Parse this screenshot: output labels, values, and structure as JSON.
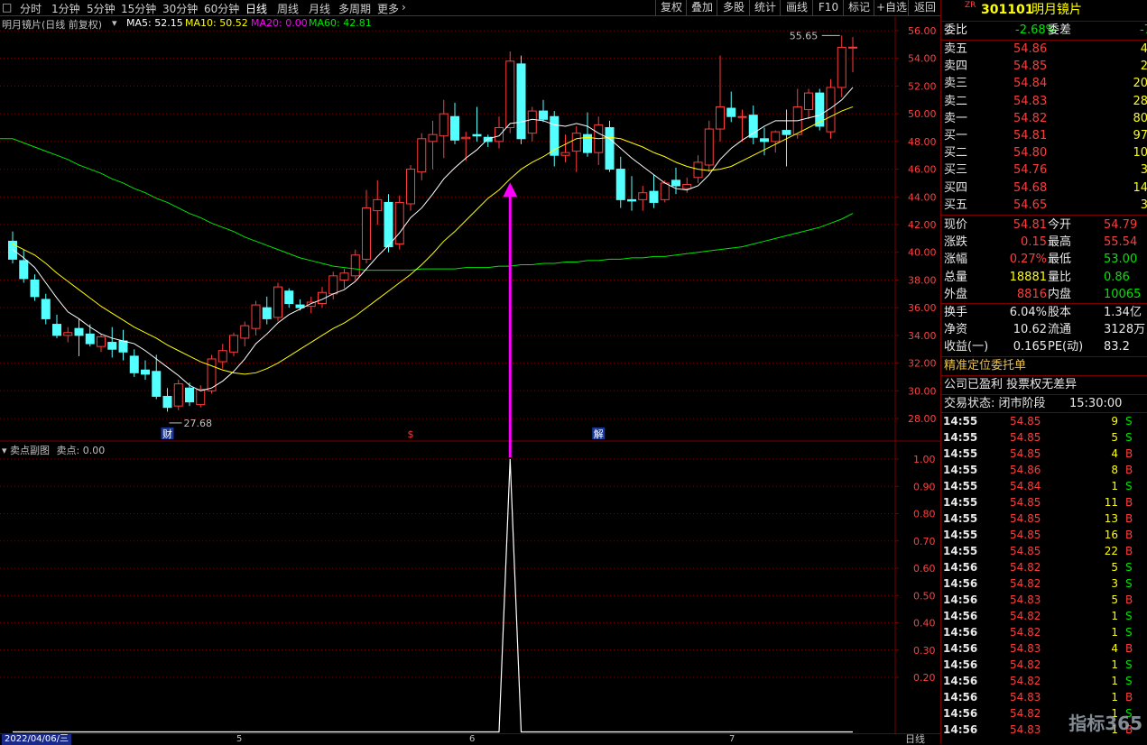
{
  "toolbar": {
    "periods": [
      "分时",
      "1分钟",
      "5分钟",
      "15分钟",
      "30分钟",
      "60分钟",
      "日线",
      "周线",
      "月线",
      "多周期",
      "更多"
    ],
    "active_period": "日线",
    "right_buttons": [
      "复权",
      "叠加",
      "多股",
      "统计",
      "画线",
      "F10",
      "标记",
      "+自选",
      "返回"
    ]
  },
  "main_chart": {
    "title": "明月镜片(日线 前复权)",
    "ma5_label": "MA5: 52.15",
    "ma10_label": "MA10: 50.52",
    "ma20_label": "MA20: 0.00",
    "ma60_label": "MA60: 42.81",
    "y_ticks": [
      "56.00",
      "54.00",
      "52.00",
      "50.00",
      "48.00",
      "46.00",
      "44.00",
      "42.00",
      "40.00",
      "38.00",
      "36.00",
      "34.00",
      "32.00",
      "30.00",
      "28.00"
    ],
    "high_marker": "55.65",
    "low_marker": "27.68",
    "event_markers": [
      "财",
      "$",
      "解"
    ]
  },
  "sub_chart": {
    "title": "卖点副图",
    "value_label": "卖点: 0.00",
    "y_ticks": [
      "1.00",
      "0.90",
      "0.80",
      "0.70",
      "0.60",
      "0.50",
      "0.40",
      "0.30",
      "0.20"
    ]
  },
  "bottom_bar": {
    "date": "2022/04/06/三",
    "month_ticks": [
      "5",
      "6",
      "7"
    ],
    "period_label": "日线"
  },
  "quote": {
    "badge": "ZR",
    "code": "301101",
    "name": "明月镜片",
    "weibi_label": "委比",
    "weibi_value": "-2.68%",
    "weicha_label": "委差",
    "weicha_value": "-7",
    "asks": [
      {
        "label": "卖五",
        "price": "54.86",
        "vol": "4"
      },
      {
        "label": "卖四",
        "price": "54.85",
        "vol": "2"
      },
      {
        "label": "卖三",
        "price": "54.84",
        "vol": "20"
      },
      {
        "label": "卖二",
        "price": "54.83",
        "vol": "28"
      },
      {
        "label": "卖一",
        "price": "54.82",
        "vol": "80"
      }
    ],
    "bids": [
      {
        "label": "买一",
        "price": "54.81",
        "vol": "97"
      },
      {
        "label": "买二",
        "price": "54.80",
        "vol": "10"
      },
      {
        "label": "买三",
        "price": "54.76",
        "vol": "3"
      },
      {
        "label": "买四",
        "price": "54.68",
        "vol": "14"
      },
      {
        "label": "买五",
        "price": "54.65",
        "vol": "3"
      }
    ],
    "stats": [
      {
        "l1": "现价",
        "v1": "54.81",
        "c1": "red",
        "l2": "今开",
        "v2": "54.79",
        "c2": "red"
      },
      {
        "l1": "涨跌",
        "v1": "0.15",
        "c1": "red",
        "l2": "最高",
        "v2": "55.54",
        "c2": "red"
      },
      {
        "l1": "涨幅",
        "v1": "0.27%",
        "c1": "red",
        "l2": "最低",
        "v2": "53.00",
        "c2": "green"
      },
      {
        "l1": "总量",
        "v1": "18881",
        "c1": "yellow",
        "l2": "量比",
        "v2": "0.86",
        "c2": "green"
      },
      {
        "l1": "外盘",
        "v1": "8816",
        "c1": "red",
        "l2": "内盘",
        "v2": "10065",
        "c2": "green"
      }
    ],
    "stats2": [
      {
        "l1": "换手",
        "v1": "6.04%",
        "l2": "股本",
        "v2": "1.34亿"
      },
      {
        "l1": "净资",
        "v1": "10.62",
        "l2": "流通",
        "v2": "3128万"
      },
      {
        "l1": "收益(一)",
        "v1": "0.165",
        "l2": "PE(动)",
        "v2": "83.2"
      }
    ],
    "precise_order": "精准定位委托单",
    "company_note": "公司已盈利 投票权无差异",
    "status_label": "交易状态: 闭市阶段",
    "status_time": "15:30:00",
    "trades": [
      {
        "t": "14:55",
        "p": "54.85",
        "v": "9",
        "s": "S"
      },
      {
        "t": "14:55",
        "p": "54.85",
        "v": "5",
        "s": "S"
      },
      {
        "t": "14:55",
        "p": "54.85",
        "v": "4",
        "s": "B"
      },
      {
        "t": "14:55",
        "p": "54.86",
        "v": "8",
        "s": "B"
      },
      {
        "t": "14:55",
        "p": "54.84",
        "v": "1",
        "s": "S"
      },
      {
        "t": "14:55",
        "p": "54.85",
        "v": "11",
        "s": "B"
      },
      {
        "t": "14:55",
        "p": "54.85",
        "v": "13",
        "s": "B"
      },
      {
        "t": "14:55",
        "p": "54.85",
        "v": "16",
        "s": "B"
      },
      {
        "t": "14:55",
        "p": "54.85",
        "v": "22",
        "s": "B"
      },
      {
        "t": "14:56",
        "p": "54.82",
        "v": "5",
        "s": "S"
      },
      {
        "t": "14:56",
        "p": "54.82",
        "v": "3",
        "s": "S"
      },
      {
        "t": "14:56",
        "p": "54.83",
        "v": "5",
        "s": "B"
      },
      {
        "t": "14:56",
        "p": "54.82",
        "v": "1",
        "s": "S"
      },
      {
        "t": "14:56",
        "p": "54.82",
        "v": "1",
        "s": "S"
      },
      {
        "t": "14:56",
        "p": "54.83",
        "v": "4",
        "s": "B"
      },
      {
        "t": "14:56",
        "p": "54.82",
        "v": "1",
        "s": "S"
      },
      {
        "t": "14:56",
        "p": "54.82",
        "v": "1",
        "s": "S"
      },
      {
        "t": "14:56",
        "p": "54.83",
        "v": "1",
        "s": "B"
      },
      {
        "t": "14:56",
        "p": "54.82",
        "v": "1",
        "s": "S"
      },
      {
        "t": "14:56",
        "p": "54.83",
        "v": "1",
        "s": "B"
      }
    ]
  },
  "watermark": "指标365",
  "colors": {
    "up": "#ff3c3c",
    "down": "#54ffff",
    "ma5": "#ffffff",
    "ma10": "#ffff00",
    "ma20": "#ff00ff",
    "ma60": "#00e600",
    "arrow": "#ff00ff",
    "grid": "#7a0000"
  },
  "chart_data": {
    "type": "candlestick",
    "y_range": [
      27,
      57
    ],
    "candles": [
      [
        40.8,
        41.5,
        39.2,
        39.5
      ],
      [
        39.4,
        40.2,
        37.8,
        38.1
      ],
      [
        38.0,
        38.4,
        36.5,
        36.8
      ],
      [
        36.6,
        37.0,
        34.8,
        35.2
      ],
      [
        34.8,
        35.5,
        33.8,
        34.0
      ],
      [
        34.0,
        34.6,
        33.5,
        34.2
      ],
      [
        34.5,
        35.2,
        32.5,
        34.0
      ],
      [
        34.1,
        34.8,
        33.2,
        33.4
      ],
      [
        33.2,
        34.1,
        32.8,
        33.9
      ],
      [
        33.5,
        34.6,
        32.4,
        33.0
      ],
      [
        33.6,
        34.4,
        32.2,
        32.8
      ],
      [
        32.5,
        33.0,
        31.0,
        31.3
      ],
      [
        31.5,
        32.2,
        30.8,
        31.2
      ],
      [
        31.4,
        32.6,
        29.4,
        29.6
      ],
      [
        29.6,
        30.2,
        28.5,
        28.8
      ],
      [
        28.9,
        30.8,
        28.6,
        30.5
      ],
      [
        30.2,
        30.6,
        28.9,
        29.2
      ],
      [
        29.0,
        30.4,
        28.8,
        30.1
      ],
      [
        30.0,
        32.6,
        29.8,
        32.3
      ],
      [
        32.1,
        33.4,
        31.6,
        32.9
      ],
      [
        32.8,
        34.2,
        32.5,
        34.0
      ],
      [
        33.8,
        35.0,
        33.2,
        34.7
      ],
      [
        34.5,
        36.5,
        34.0,
        36.2
      ],
      [
        36.0,
        36.8,
        34.8,
        35.2
      ],
      [
        35.3,
        37.8,
        35.0,
        37.5
      ],
      [
        37.2,
        37.4,
        36.0,
        36.3
      ],
      [
        36.2,
        36.6,
        35.8,
        36.0
      ],
      [
        36.1,
        36.8,
        35.6,
        36.4
      ],
      [
        36.3,
        37.5,
        36.0,
        37.1
      ],
      [
        37.0,
        38.6,
        36.6,
        38.3
      ],
      [
        38.0,
        38.8,
        37.4,
        38.5
      ],
      [
        38.3,
        40.2,
        38.0,
        39.8
      ],
      [
        39.5,
        44.5,
        39.2,
        43.2
      ],
      [
        43.0,
        45.2,
        42.0,
        43.8
      ],
      [
        43.6,
        44.2,
        40.0,
        40.4
      ],
      [
        40.6,
        44.1,
        40.2,
        43.6
      ],
      [
        43.5,
        46.3,
        43.0,
        46.0
      ],
      [
        45.8,
        48.6,
        45.2,
        48.2
      ],
      [
        48.0,
        49.5,
        46.0,
        48.5
      ],
      [
        48.4,
        51.0,
        46.8,
        50.0
      ],
      [
        49.8,
        50.8,
        47.8,
        48.1
      ],
      [
        48.2,
        48.7,
        46.6,
        48.3
      ],
      [
        48.5,
        50.5,
        48.0,
        48.4
      ],
      [
        48.3,
        48.5,
        47.6,
        48.0
      ],
      [
        48.0,
        49.8,
        47.5,
        49.0
      ],
      [
        49.0,
        54.5,
        48.6,
        53.8
      ],
      [
        53.6,
        54.2,
        47.8,
        48.2
      ],
      [
        48.6,
        50.5,
        48.0,
        50.2
      ],
      [
        50.2,
        51.0,
        49.4,
        49.6
      ],
      [
        49.8,
        50.2,
        46.2,
        47.0
      ],
      [
        47.0,
        48.5,
        46.5,
        47.2
      ],
      [
        47.3,
        49.1,
        45.8,
        48.6
      ],
      [
        48.5,
        50.1,
        46.9,
        47.2
      ],
      [
        47.2,
        49.8,
        46.3,
        49.2
      ],
      [
        49.0,
        49.5,
        45.8,
        46.0
      ],
      [
        46.0,
        46.9,
        43.2,
        43.8
      ],
      [
        43.8,
        45.5,
        43.0,
        43.7
      ],
      [
        43.8,
        44.8,
        43.0,
        44.3
      ],
      [
        44.4,
        45.6,
        43.2,
        43.6
      ],
      [
        43.8,
        45.2,
        43.6,
        45.0
      ],
      [
        45.2,
        46.1,
        44.2,
        44.8
      ],
      [
        44.6,
        45.4,
        44.3,
        44.9
      ],
      [
        45.4,
        47.0,
        45.0,
        46.5
      ],
      [
        46.3,
        49.5,
        45.8,
        48.9
      ],
      [
        48.9,
        54.2,
        48.0,
        50.5
      ],
      [
        50.4,
        51.6,
        49.4,
        49.8
      ],
      [
        49.8,
        50.3,
        48.0,
        49.8
      ],
      [
        49.9,
        50.6,
        47.8,
        48.3
      ],
      [
        48.2,
        49.0,
        47.0,
        48.0
      ],
      [
        48.0,
        48.8,
        47.2,
        48.7
      ],
      [
        48.8,
        50.3,
        46.2,
        48.5
      ],
      [
        48.5,
        51.8,
        48.2,
        50.5
      ],
      [
        50.3,
        51.8,
        49.6,
        51.5
      ],
      [
        51.5,
        51.8,
        48.8,
        49.1
      ],
      [
        48.7,
        52.5,
        48.2,
        51.9
      ],
      [
        51.9,
        55.65,
        51.2,
        54.8
      ],
      [
        54.8,
        55.54,
        53.0,
        54.81
      ]
    ],
    "ma5": [
      40.2,
      39.6,
      38.9,
      37.8,
      36.7,
      35.7,
      35.2,
      34.6,
      34.1,
      33.8,
      33.6,
      33.4,
      32.9,
      32.3,
      31.7,
      31.1,
      30.4,
      30.0,
      30.2,
      30.7,
      31.4,
      32.3,
      33.4,
      34.1,
      34.9,
      35.5,
      35.9,
      36.3,
      36.6,
      37.0,
      37.3,
      37.9,
      38.8,
      39.7,
      40.5,
      41.4,
      42.5,
      43.2,
      44.2,
      45.3,
      46.1,
      46.8,
      47.4,
      48.2,
      48.4,
      49.3,
      49.4,
      49.6,
      49.5,
      49.2,
      49.1,
      49.3,
      49.1,
      48.6,
      48.2,
      47.5,
      46.8,
      46.2,
      45.6,
      45.0,
      44.6,
      44.5,
      44.8,
      45.6,
      46.7,
      47.5,
      48.1,
      48.6,
      49.1,
      49.5,
      49.5,
      49.5,
      49.7,
      49.9,
      50.4,
      51.0,
      51.9
    ],
    "ma10": [
      40.6,
      40.2,
      39.8,
      39.2,
      38.5,
      37.9,
      37.3,
      36.7,
      36.1,
      35.6,
      35.1,
      34.6,
      34.2,
      33.8,
      33.3,
      32.9,
      32.5,
      32.1,
      31.8,
      31.5,
      31.3,
      31.2,
      31.3,
      31.6,
      32.0,
      32.5,
      33.0,
      33.5,
      34.0,
      34.5,
      34.9,
      35.4,
      36.0,
      36.6,
      37.2,
      37.8,
      38.4,
      39.1,
      39.9,
      40.8,
      41.5,
      42.3,
      43.1,
      43.9,
      44.5,
      45.3,
      46.0,
      46.5,
      46.9,
      47.4,
      47.8,
      48.2,
      48.3,
      48.2,
      48.3,
      48.2,
      47.9,
      47.6,
      47.2,
      46.9,
      46.5,
      46.2,
      46.0,
      45.9,
      46.0,
      46.2,
      46.6,
      47.0,
      47.4,
      47.8,
      48.2,
      48.6,
      49.0,
      49.4,
      49.8,
      50.2,
      50.5
    ],
    "ma60": [
      48.2,
      47.9,
      47.6,
      47.3,
      47.0,
      46.7,
      46.3,
      46.0,
      45.7,
      45.3,
      45.0,
      44.6,
      44.3,
      43.9,
      43.6,
      43.2,
      42.8,
      42.5,
      42.1,
      41.8,
      41.5,
      41.1,
      40.8,
      40.5,
      40.2,
      39.9,
      39.6,
      39.4,
      39.2,
      39.0,
      38.9,
      38.8,
      38.7,
      38.7,
      38.7,
      38.7,
      38.7,
      38.8,
      38.8,
      38.8,
      38.8,
      38.9,
      38.9,
      38.9,
      39.0,
      39.0,
      39.1,
      39.1,
      39.2,
      39.2,
      39.3,
      39.3,
      39.4,
      39.4,
      39.5,
      39.5,
      39.6,
      39.6,
      39.7,
      39.7,
      39.8,
      39.9,
      40.0,
      40.1,
      40.2,
      40.3,
      40.4,
      40.6,
      40.8,
      41.0,
      41.2,
      41.4,
      41.6,
      41.8,
      42.1,
      42.4,
      42.81
    ],
    "sell_signal": {
      "index": 45,
      "value": 1.0,
      "y_range": [
        0,
        1.05
      ]
    }
  }
}
